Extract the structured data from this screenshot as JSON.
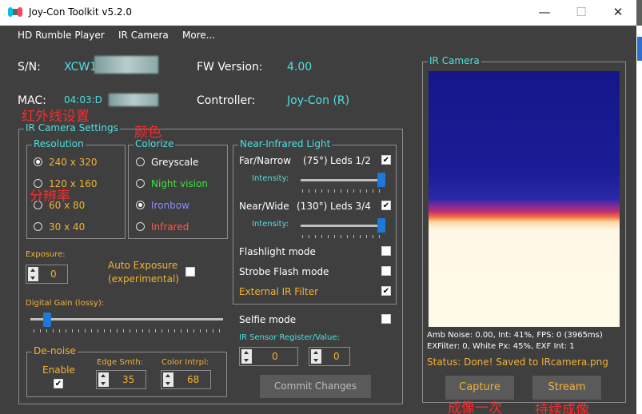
{
  "window": {
    "title": "Joy-Con Toolkit v5.2.0",
    "minimize": "—",
    "maximize": "☐",
    "close": "✕"
  },
  "menu": [
    "HD Rumble Player",
    "IR Camera",
    "More..."
  ],
  "info": {
    "sn_label": "S/N:",
    "sn_value": "XCW1",
    "fw_label": "FW Version:",
    "fw_value": "4.00",
    "mac_label": "MAC:",
    "mac_value": "04:03:D",
    "controller_label": "Controller:",
    "controller_value": "Joy-Con (R)"
  },
  "annotations": {
    "ir_settings": "红外线设置",
    "colorize": "颜色",
    "resolution": "分辨率",
    "capture": "成像一次",
    "stream": "持续成像"
  },
  "ir_settings": {
    "title": "IR Camera Settings",
    "resolution": {
      "title": "Resolution",
      "options": [
        "240 x 320",
        "120 x 160",
        "60 x 80",
        "30 x 40"
      ],
      "selected_index": 0
    },
    "colorize": {
      "title": "Colorize",
      "options": [
        "Greyscale",
        "Night vision",
        "Ironbow",
        "Infrared"
      ],
      "selected_index": 2,
      "option_colors": [
        "#ffffff",
        "#3ee23e",
        "#8b8bff",
        "#ff5a4a"
      ]
    },
    "exposure": {
      "label": "Exposure:",
      "value": "0"
    },
    "auto_exposure": {
      "label1": "Auto Exposure",
      "label2": "(experimental)",
      "checked": false
    },
    "digital_gain": {
      "label": "Digital Gain (lossy):",
      "level": 0.07
    },
    "denoise": {
      "title": "De-noise",
      "enable_label": "Enable",
      "enable_checked": true,
      "edge_label": "Edge Smth:",
      "edge_value": "35",
      "color_label": "Color Intrpl:",
      "color_value": "68"
    },
    "nir": {
      "title": "Near-Infrared Light",
      "far_label": "Far/Narrow",
      "far_angle": "(75°)",
      "far_leds": "Leds 1/2",
      "far_checked": true,
      "intensity_label": "Intensity:",
      "far_intensity": 1.0,
      "near_label": "Near/Wide",
      "near_angle": "(130°)",
      "near_leds": "Leds 3/4",
      "near_checked": true,
      "near_intensity": 1.0,
      "flashlight_label": "Flashlight mode",
      "flashlight_checked": false,
      "strobe_label": "Strobe Flash mode",
      "strobe_checked": false,
      "external_label": "External IR Filter",
      "external_checked": true
    },
    "selfie": {
      "label": "Selfie mode",
      "checked": false
    },
    "register": {
      "label": "IR Sensor Register/Value:",
      "reg": "0",
      "val": "0"
    },
    "commit": "Commit Changes"
  },
  "ir_camera": {
    "title": "IR Camera",
    "stats1": "Amb Noise: 0.00,  Int: 41%,  FPS: 0 (3965ms)",
    "stats2": "EXFilter: 0,  White Px: 45%,  EXF Int: 1",
    "status": "Status: Done! Saved to IRcamera.png",
    "capture": "Capture",
    "stream": "Stream"
  },
  "colors": {
    "accent_cyan": "#4fe0e0",
    "accent_orange": "#f2b234",
    "annotation_red": "#ff2a2a"
  }
}
